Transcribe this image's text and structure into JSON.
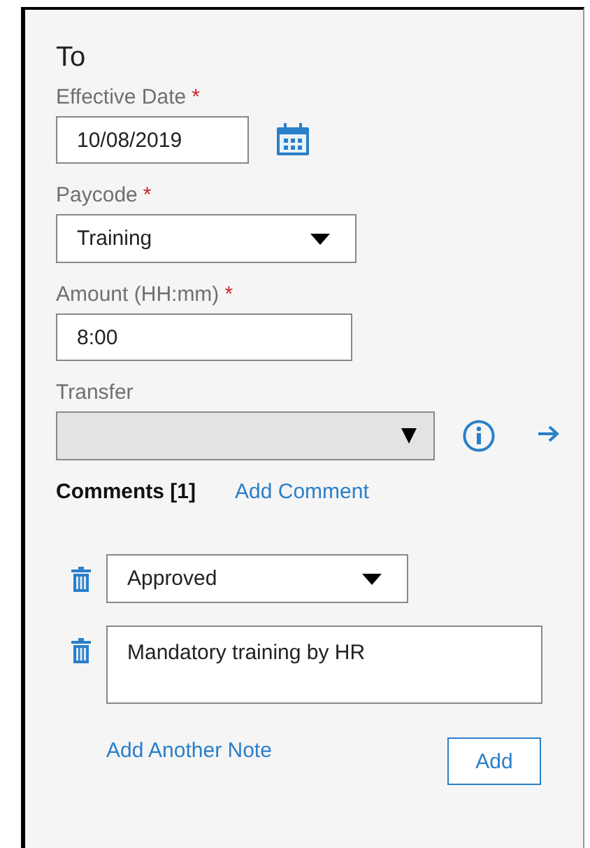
{
  "title": "To",
  "fields": [
    {
      "kind": "date",
      "label": "Effective Date",
      "required_mark": "*",
      "value": "10/08/2019"
    },
    {
      "kind": "select",
      "label": "Paycode",
      "required_mark": "*",
      "value": "Training"
    },
    {
      "kind": "text",
      "label": "Amount (HH:mm)",
      "required_mark": "*",
      "value": "8:00"
    },
    {
      "kind": "transfer",
      "label": "Transfer",
      "disabled": true
    }
  ],
  "comments": {
    "heading": "Comments [1]",
    "add_comment": "Add Comment",
    "notes": [
      {
        "kind": "select",
        "value": "Approved"
      },
      {
        "kind": "text",
        "value": "Mandatory training by HR"
      }
    ],
    "add_another_note": "Add Another Note",
    "add_button": "Add"
  }
}
